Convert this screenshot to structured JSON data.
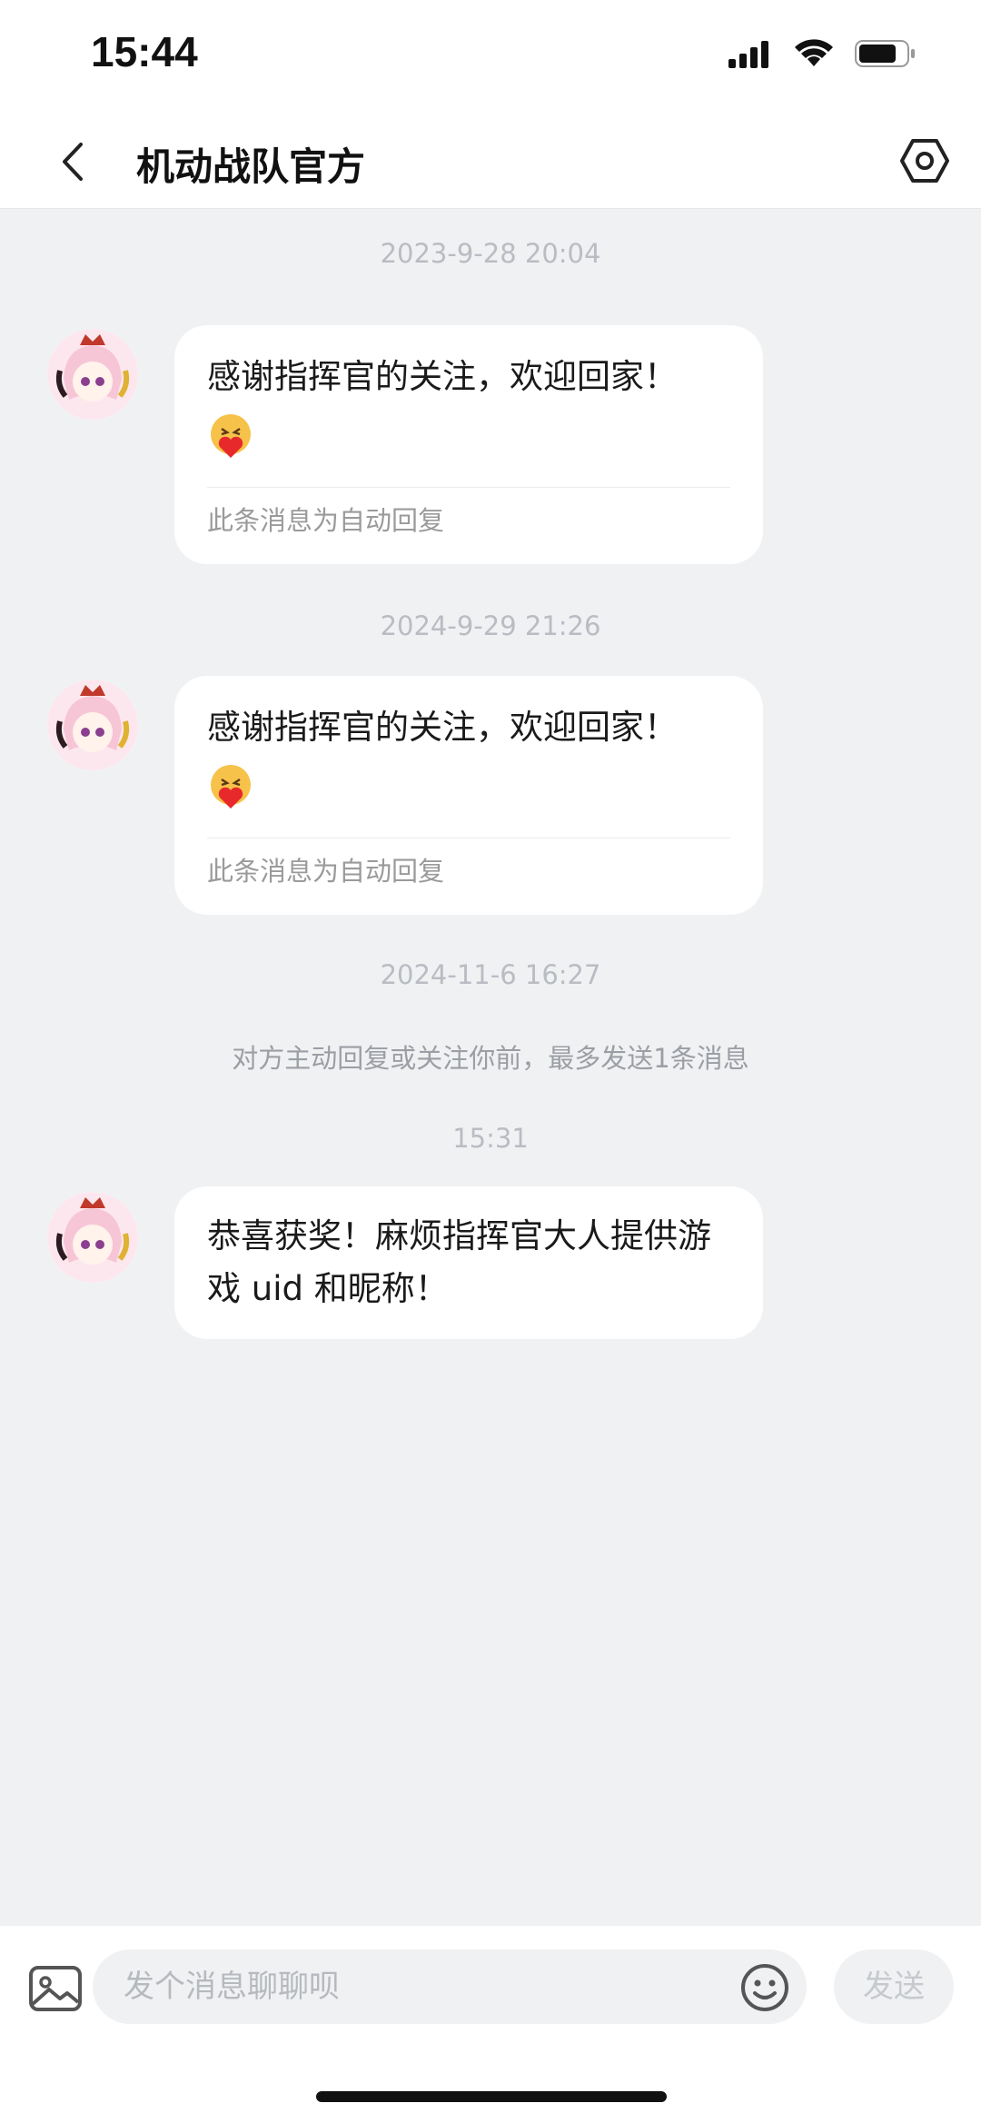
{
  "status_bar": {
    "time": "15:44"
  },
  "header": {
    "title": "机动战队官方"
  },
  "messages": [
    {
      "timestamp": "2023-9-28 20:04",
      "text": "感谢指挥官的关注，欢迎回家！",
      "footer": "此条消息为自动回复"
    },
    {
      "timestamp": "2024-9-29 21:26",
      "text": "感谢指挥官的关注，欢迎回家！",
      "footer": "此条消息为自动回复"
    },
    {
      "timestamp": "2024-11-6 16:27",
      "notice": "对方主动回复或关注你前，最多发送1条消息"
    },
    {
      "timestamp": "15:31",
      "text": "恭喜获奖！麻烦指挥官大人提供游戏 uid 和昵称！"
    }
  ],
  "input": {
    "placeholder": "发个消息聊聊呗",
    "send_label": "发送"
  },
  "icons": {
    "back": "chevron-left-icon",
    "settings": "hexagon-gear-icon",
    "image": "image-icon",
    "emoji": "smiley-icon"
  },
  "colors": {
    "background": "#f0f1f3",
    "bubble": "#ffffff",
    "timestamp": "#b9bcc2"
  }
}
